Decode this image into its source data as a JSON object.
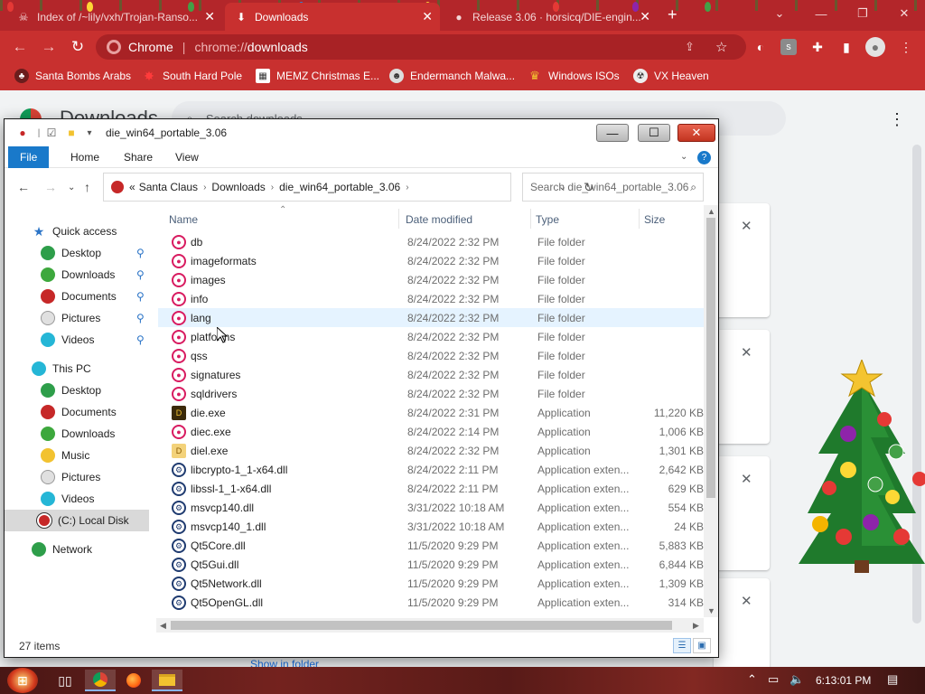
{
  "chrome": {
    "tabs": [
      {
        "title": "Index of /~lily/vxh/Trojan-Ranso...",
        "icon": "skull-icon",
        "active": false
      },
      {
        "title": "Downloads",
        "icon": "download-icon",
        "active": true
      },
      {
        "title": "Release 3.06 · horsicq/DIE-engin...",
        "icon": "github-icon",
        "active": false
      }
    ],
    "new_tab": "+",
    "omnibox": {
      "site_label": "Chrome",
      "url_scheme": "chrome://",
      "url_path": "downloads"
    },
    "bookmarks": [
      {
        "label": "Santa Bombs Arabs",
        "icon": "santa-icon"
      },
      {
        "label": "South Hard Pole",
        "icon": "maple-leaf-icon"
      },
      {
        "label": "MEMZ Christmas E...",
        "icon": "memz-icon"
      },
      {
        "label": "Endermanch Malwa...",
        "icon": "ender-icon"
      },
      {
        "label": "Windows ISOs",
        "icon": "trophy-icon"
      },
      {
        "label": "VX Heaven",
        "icon": "vx-icon"
      }
    ]
  },
  "downloads_page": {
    "title": "Downloads",
    "search_placeholder": "Search downloads",
    "show_in_folder": "Show in folder"
  },
  "explorer": {
    "title": "die_win64_portable_3.06",
    "ribbon_tabs": [
      "File",
      "Home",
      "Share",
      "View"
    ],
    "breadcrumb": [
      "Santa Claus",
      "Downloads",
      "die_win64_portable_3.06"
    ],
    "breadcrumb_prefix": "«",
    "search_placeholder": "Search die_win64_portable_3.06",
    "quick_access": "Quick access",
    "nav": [
      {
        "label": "Desktop",
        "group": "quick",
        "pinned": true,
        "icon": "ornament-icon",
        "color": "#2e9e4a"
      },
      {
        "label": "Downloads",
        "group": "quick",
        "pinned": true,
        "icon": "ornament-icon",
        "color": "#3da83d"
      },
      {
        "label": "Documents",
        "group": "quick",
        "pinned": true,
        "icon": "ornament-icon",
        "color": "#c62828"
      },
      {
        "label": "Pictures",
        "group": "quick",
        "pinned": true,
        "icon": "ornament-icon",
        "color": "#e0e0e0"
      },
      {
        "label": "Videos",
        "group": "quick",
        "pinned": true,
        "icon": "ornament-icon",
        "color": "#25b6d6"
      },
      {
        "label": "This PC",
        "group": "root",
        "pinned": false,
        "icon": "ornament-icon",
        "color": "#25b6d6"
      },
      {
        "label": "Desktop",
        "group": "pc",
        "pinned": false,
        "icon": "ornament-icon",
        "color": "#2e9e4a"
      },
      {
        "label": "Documents",
        "group": "pc",
        "pinned": false,
        "icon": "ornament-icon",
        "color": "#c62828"
      },
      {
        "label": "Downloads",
        "group": "pc",
        "pinned": false,
        "icon": "ornament-icon",
        "color": "#3da83d"
      },
      {
        "label": "Music",
        "group": "pc",
        "pinned": false,
        "icon": "ornament-icon",
        "color": "#f2c230"
      },
      {
        "label": "Pictures",
        "group": "pc",
        "pinned": false,
        "icon": "ornament-icon",
        "color": "#e0e0e0"
      },
      {
        "label": "Videos",
        "group": "pc",
        "pinned": false,
        "icon": "ornament-icon",
        "color": "#25b6d6"
      },
      {
        "label": "(C:) Local Disk",
        "group": "pc",
        "pinned": false,
        "icon": "disk-icon",
        "color": "#c62828",
        "selected": true
      },
      {
        "label": "Network",
        "group": "root",
        "pinned": false,
        "icon": "ornament-icon",
        "color": "#2e9e4a"
      }
    ],
    "columns": [
      "Name",
      "Date modified",
      "Type",
      "Size"
    ],
    "files": [
      {
        "name": "db",
        "date": "8/24/2022 2:32 PM",
        "type": "File folder",
        "size": "",
        "icon": "folder-icon"
      },
      {
        "name": "imageformats",
        "date": "8/24/2022 2:32 PM",
        "type": "File folder",
        "size": "",
        "icon": "folder-icon"
      },
      {
        "name": "images",
        "date": "8/24/2022 2:32 PM",
        "type": "File folder",
        "size": "",
        "icon": "folder-icon"
      },
      {
        "name": "info",
        "date": "8/24/2022 2:32 PM",
        "type": "File folder",
        "size": "",
        "icon": "folder-icon"
      },
      {
        "name": "lang",
        "date": "8/24/2022 2:32 PM",
        "type": "File folder",
        "size": "",
        "icon": "folder-icon",
        "hover": true
      },
      {
        "name": "platforms",
        "date": "8/24/2022 2:32 PM",
        "type": "File folder",
        "size": "",
        "icon": "folder-icon"
      },
      {
        "name": "qss",
        "date": "8/24/2022 2:32 PM",
        "type": "File folder",
        "size": "",
        "icon": "folder-icon"
      },
      {
        "name": "signatures",
        "date": "8/24/2022 2:32 PM",
        "type": "File folder",
        "size": "",
        "icon": "folder-icon"
      },
      {
        "name": "sqldrivers",
        "date": "8/24/2022 2:32 PM",
        "type": "File folder",
        "size": "",
        "icon": "folder-icon"
      },
      {
        "name": "die.exe",
        "date": "8/24/2022 2:31 PM",
        "type": "Application",
        "size": "11,220 KB",
        "icon": "die-app-icon"
      },
      {
        "name": "diec.exe",
        "date": "8/24/2022 2:14 PM",
        "type": "Application",
        "size": "1,006 KB",
        "icon": "console-app-icon"
      },
      {
        "name": "diel.exe",
        "date": "8/24/2022 2:32 PM",
        "type": "Application",
        "size": "1,301 KB",
        "icon": "die-lite-app-icon"
      },
      {
        "name": "libcrypto-1_1-x64.dll",
        "date": "8/24/2022 2:11 PM",
        "type": "Application exten...",
        "size": "2,642 KB",
        "icon": "dll-icon"
      },
      {
        "name": "libssl-1_1-x64.dll",
        "date": "8/24/2022 2:11 PM",
        "type": "Application exten...",
        "size": "629 KB",
        "icon": "dll-icon"
      },
      {
        "name": "msvcp140.dll",
        "date": "3/31/2022 10:18 AM",
        "type": "Application exten...",
        "size": "554 KB",
        "icon": "dll-icon"
      },
      {
        "name": "msvcp140_1.dll",
        "date": "3/31/2022 10:18 AM",
        "type": "Application exten...",
        "size": "24 KB",
        "icon": "dll-icon"
      },
      {
        "name": "Qt5Core.dll",
        "date": "11/5/2020 9:29 PM",
        "type": "Application exten...",
        "size": "5,883 KB",
        "icon": "dll-icon"
      },
      {
        "name": "Qt5Gui.dll",
        "date": "11/5/2020 9:29 PM",
        "type": "Application exten...",
        "size": "6,844 KB",
        "icon": "dll-icon"
      },
      {
        "name": "Qt5Network.dll",
        "date": "11/5/2020 9:29 PM",
        "type": "Application exten...",
        "size": "1,309 KB",
        "icon": "dll-icon"
      },
      {
        "name": "Qt5OpenGL.dll",
        "date": "11/5/2020 9:29 PM",
        "type": "Application exten...",
        "size": "314 KB",
        "icon": "dll-icon"
      }
    ],
    "status": "27 items"
  },
  "taskbar": {
    "apps": [
      {
        "name": "task-view",
        "icon": "task-view-icon",
        "active": false
      },
      {
        "name": "chrome",
        "icon": "chrome-icon",
        "active": true
      },
      {
        "name": "firefox",
        "icon": "firefox-icon",
        "active": false
      },
      {
        "name": "file-explorer",
        "icon": "folder-icon",
        "active": true
      }
    ],
    "clock": "6:13:01 PM"
  },
  "colors": {
    "chrome_tabstrip": "#b3262a",
    "chrome_toolbar": "#c8302f",
    "explorer_accent": "#1979ca",
    "close_button": "#c23420",
    "row_hover": "#e5f3ff",
    "header_text": "#4c607a"
  }
}
